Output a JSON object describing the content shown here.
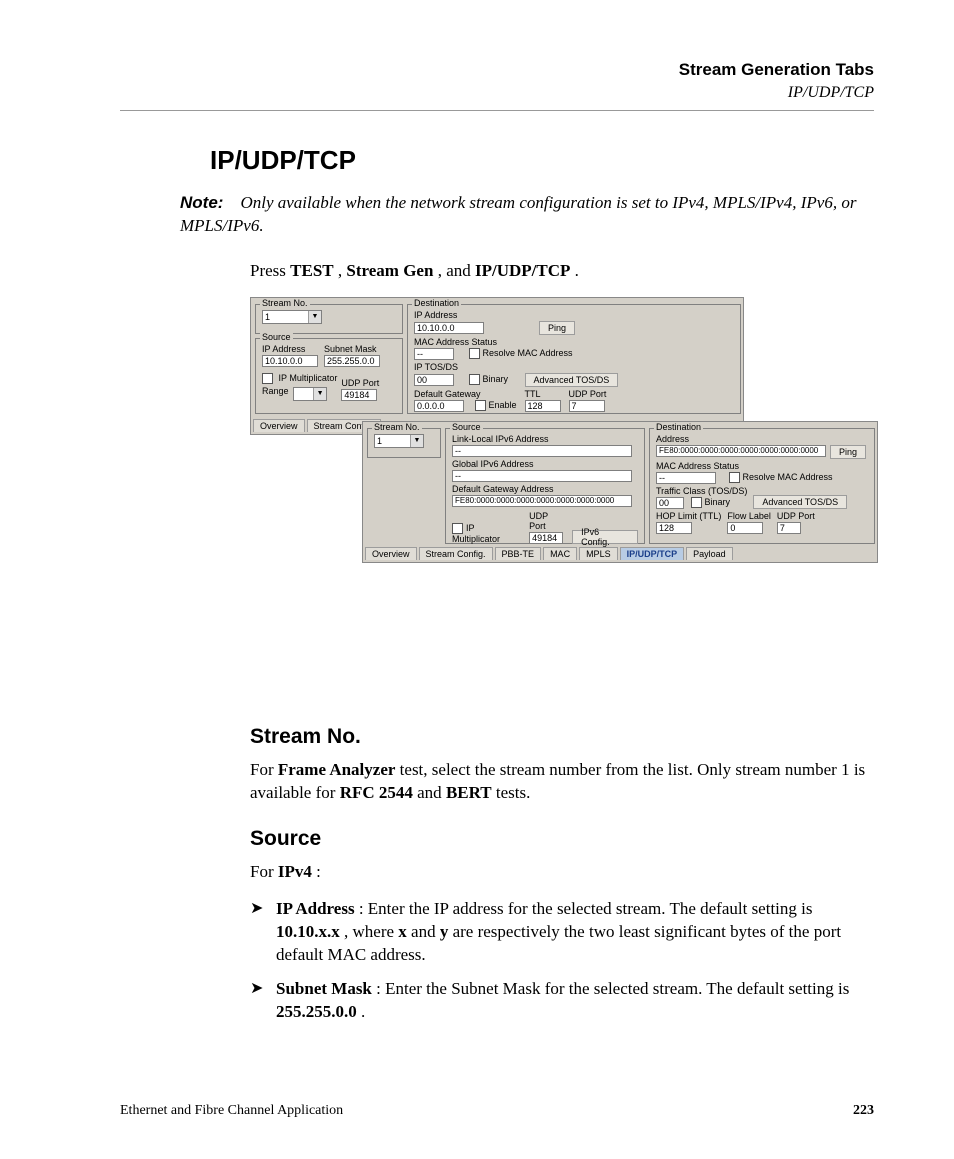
{
  "header": {
    "title": "Stream Generation Tabs",
    "sub": "IP/UDP/TCP"
  },
  "h1": "IP/UDP/TCP",
  "note_label": "Note:",
  "note_body": "Only available when the network stream configuration is set to IPv4, MPLS/IPv4, IPv6, or MPLS/IPv6.",
  "press_pre": "Press ",
  "press_b1": "TEST",
  "press_m1": ", ",
  "press_b2": "Stream Gen",
  "press_m2": ", and ",
  "press_b3": "IP/UDP/TCP",
  "press_post": ".",
  "streamno_h": "Stream No.",
  "streamno_1a": "For ",
  "streamno_1b": "Frame Analyzer",
  "streamno_1c": " test, select the stream number from the list. Only stream number 1 is available for ",
  "streamno_1d": "RFC 2544",
  "streamno_1e": " and ",
  "streamno_1f": "BERT",
  "streamno_1g": " tests.",
  "source_h": "Source",
  "source_for1": "For ",
  "source_for2": "IPv4",
  "source_for3": ":",
  "b1_a": "IP Address",
  "b1_b": ": Enter the IP address for the selected stream. The default setting is ",
  "b1_c": "10.10.x.x",
  "b1_d": ", where ",
  "b1_e": "x",
  "b1_f": " and ",
  "b1_g": "y",
  "b1_h": " are respectively the two least significant bytes of the port default MAC address.",
  "b2_a": "Subnet Mask",
  "b2_b": ": Enter the Subnet Mask for the selected stream. The default setting is ",
  "b2_c": "255.255.0.0",
  "b2_d": ".",
  "arrow": "➤",
  "footer_left": "Ethernet and Fibre Channel Application",
  "footer_page": "223",
  "shot": {
    "a": {
      "stream_no_lbl": "Stream No.",
      "stream_no_val": "1",
      "src_lbl": "Source",
      "ip_lbl": "IP Address",
      "ip_val": "10.10.0.0",
      "mask_lbl": "Subnet Mask",
      "mask_val": "255.255.0.0",
      "ipmult": "IP Multiplicator",
      "range_lbl": "Range",
      "udp_lbl": "UDP Port",
      "udp_val": "49184",
      "dest_lbl": "Destination",
      "dest_ip_lbl": "IP Address",
      "dest_ip_val": "10.10.0.0",
      "ping": "Ping",
      "mac_lbl": "MAC Address Status",
      "mac_val": "--",
      "res_mac": "Resolve MAC Address",
      "tos_lbl": "IP TOS/DS",
      "tos_val": "00",
      "binary": "Binary",
      "adv_tos": "Advanced TOS/DS",
      "gw_lbl": "Default Gateway",
      "gw_val": "0.0.0.0",
      "enable": "Enable",
      "ttl_lbl": "TTL",
      "ttl_val": "128",
      "udp2_lbl": "UDP Port",
      "udp2_val": "7",
      "tab_over": "Overview",
      "tab_stream": "Stream Config."
    },
    "b": {
      "stream_no_lbl": "Stream No.",
      "stream_no_val": "1",
      "src_lbl": "Source",
      "lla_lbl": "Link-Local IPv6 Address",
      "lla_val": "--",
      "gla_lbl": "Global IPv6 Address",
      "gla_val": "--",
      "dgw_lbl": "Default Gateway Address",
      "dgw_val": "FE80:0000:0000:0000:0000:0000:0000:0000",
      "ipmult": "IP Multiplicator",
      "udp_lbl": "UDP Port",
      "udp_val": "49184",
      "ipv6cfg": "IPv6 Config.",
      "dest_lbl": "Destination",
      "addr_lbl": "Address",
      "addr_val": "FE80:0000:0000:0000:0000:0000:0000:0000",
      "ping": "Ping",
      "mac_lbl": "MAC Address Status",
      "mac_val": "--",
      "res_mac": "Resolve MAC Address",
      "tc_lbl": "Traffic Class (TOS/DS)",
      "tc_val": "00",
      "binary": "Binary",
      "adv_tos": "Advanced TOS/DS",
      "hop_lbl": "HOP Limit (TTL)",
      "hop_val": "128",
      "flow_lbl": "Flow Label",
      "flow_val": "0",
      "udp2_lbl": "UDP Port",
      "udp2_val": "7",
      "tabs": {
        "overview": "Overview",
        "stream": "Stream Config.",
        "pbb": "PBB-TE",
        "mac": "MAC",
        "mpls": "MPLS",
        "ip": "IP/UDP/TCP",
        "payload": "Payload"
      }
    }
  }
}
